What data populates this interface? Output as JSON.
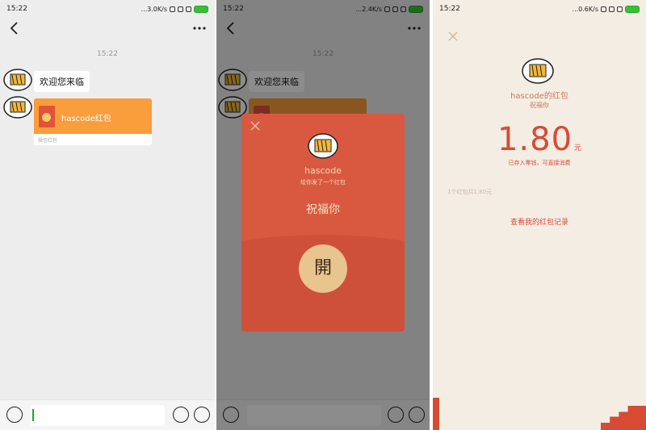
{
  "status": {
    "time": "15:22",
    "speeds": [
      "...3.0K/s",
      "...2.4K/s",
      "...0.6K/s"
    ]
  },
  "chat": {
    "timestamp": "15:22",
    "welcome_message": "欢迎您来临",
    "redpack_title": "hascode红包",
    "redpack_footer": "微信红包"
  },
  "dialog": {
    "sender": "hascode",
    "subtitle": "给你发了一个红包",
    "wish": "祝福你",
    "open_label": "開"
  },
  "result": {
    "sender_line": "hascode的红包",
    "wish": "祝福你",
    "amount": "1.80",
    "unit": "元",
    "stored_note": "已存入零钱，可直接消费",
    "count_note": "1个红包共1.80元",
    "record_link": "查看我的红包记录"
  },
  "colors": {
    "chat_bg": "#ededed",
    "redpack_orange": "#fa9d3b",
    "dialog_red": "#d95940",
    "open_gold": "#e8c48e",
    "result_bg": "#f4ede4",
    "amount_red": "#d84a34"
  },
  "icons": [
    "back-icon",
    "more-icon",
    "voice-icon",
    "emoji-icon",
    "plus-icon",
    "close-icon",
    "cartoon-avatar"
  ]
}
